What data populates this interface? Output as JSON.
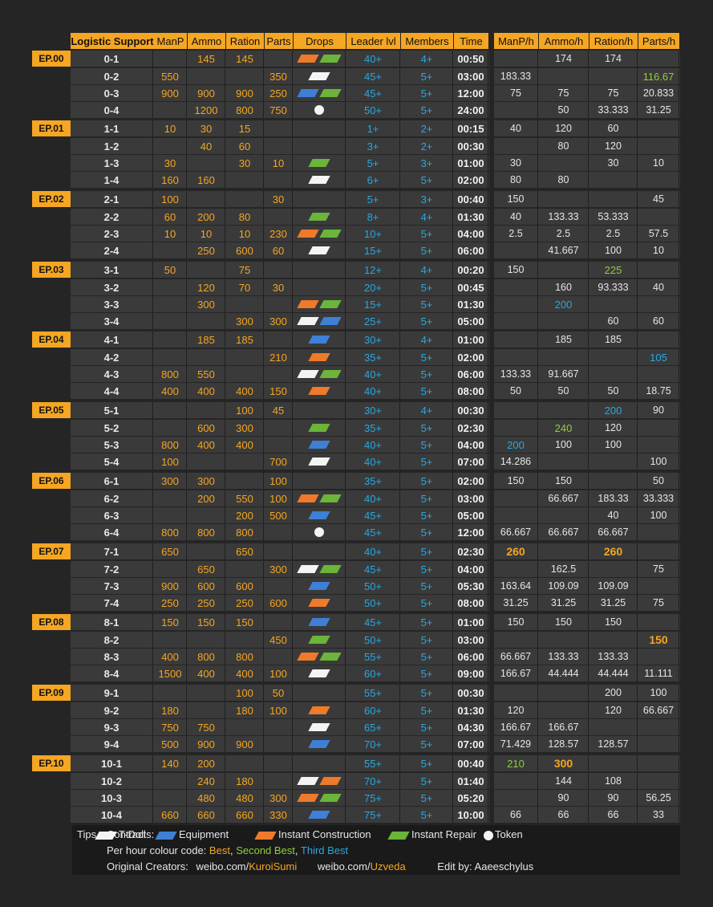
{
  "header": {
    "title": "Logistic Support",
    "cols": [
      "ManP",
      "Ammo",
      "Ration",
      "Parts",
      "Drops",
      "Leader lvl",
      "Members",
      "Time",
      "ManP/h",
      "Ammo/h",
      "Ration/h",
      "Parts/h"
    ]
  },
  "episodes": [
    {
      "label": "EP.00",
      "ops": [
        {
          "op": "0-1",
          "manp": "",
          "ammo": "145",
          "ration": "145",
          "parts": "",
          "drops": [
            "orange",
            "green"
          ],
          "lvl": "40+",
          "mem": "4+",
          "time": "00:50",
          "manph": "",
          "ammoh": "174",
          "rationh": "174",
          "partsh": ""
        },
        {
          "op": "0-2",
          "manp": "550",
          "ammo": "",
          "ration": "",
          "parts": "350",
          "drops": [
            "white"
          ],
          "lvl": "45+",
          "mem": "5+",
          "time": "03:00",
          "manph": "183.33",
          "ammoh": "",
          "rationh": "",
          "partsh": "116.67",
          "partsh_c": "second"
        },
        {
          "op": "0-3",
          "manp": "900",
          "ammo": "900",
          "ration": "900",
          "parts": "250",
          "drops": [
            "blue",
            "green"
          ],
          "lvl": "45+",
          "mem": "5+",
          "time": "12:00",
          "manph": "75",
          "ammoh": "75",
          "rationh": "75",
          "partsh": "20.833"
        },
        {
          "op": "0-4",
          "manp": "",
          "ammo": "1200",
          "ration": "800",
          "parts": "750",
          "drops": [
            "token"
          ],
          "lvl": "50+",
          "mem": "5+",
          "time": "24:00",
          "manph": "",
          "ammoh": "50",
          "rationh": "33.333",
          "partsh": "31.25"
        }
      ]
    },
    {
      "label": "EP.01",
      "ops": [
        {
          "op": "1-1",
          "manp": "10",
          "ammo": "30",
          "ration": "15",
          "parts": "",
          "drops": [],
          "lvl": "1+",
          "mem": "2+",
          "time": "00:15",
          "manph": "40",
          "ammoh": "120",
          "rationh": "60",
          "partsh": ""
        },
        {
          "op": "1-2",
          "manp": "",
          "ammo": "40",
          "ration": "60",
          "parts": "",
          "drops": [],
          "lvl": "3+",
          "mem": "2+",
          "time": "00:30",
          "manph": "",
          "ammoh": "80",
          "rationh": "120",
          "partsh": ""
        },
        {
          "op": "1-3",
          "manp": "30",
          "ammo": "",
          "ration": "30",
          "parts": "10",
          "drops": [
            "green"
          ],
          "lvl": "5+",
          "mem": "3+",
          "time": "01:00",
          "manph": "30",
          "ammoh": "",
          "rationh": "30",
          "partsh": "10"
        },
        {
          "op": "1-4",
          "manp": "160",
          "ammo": "160",
          "ration": "",
          "parts": "",
          "drops": [
            "white"
          ],
          "lvl": "6+",
          "mem": "5+",
          "time": "02:00",
          "manph": "80",
          "ammoh": "80",
          "rationh": "",
          "partsh": ""
        }
      ]
    },
    {
      "label": "EP.02",
      "ops": [
        {
          "op": "2-1",
          "manp": "100",
          "ammo": "",
          "ration": "",
          "parts": "30",
          "drops": [],
          "lvl": "5+",
          "mem": "3+",
          "time": "00:40",
          "manph": "150",
          "ammoh": "",
          "rationh": "",
          "partsh": "45"
        },
        {
          "op": "2-2",
          "manp": "60",
          "ammo": "200",
          "ration": "80",
          "parts": "",
          "drops": [
            "green"
          ],
          "lvl": "8+",
          "mem": "4+",
          "time": "01:30",
          "manph": "40",
          "ammoh": "133.33",
          "rationh": "53.333",
          "partsh": ""
        },
        {
          "op": "2-3",
          "manp": "10",
          "ammo": "10",
          "ration": "10",
          "parts": "230",
          "drops": [
            "orange",
            "green"
          ],
          "lvl": "10+",
          "mem": "5+",
          "time": "04:00",
          "manph": "2.5",
          "ammoh": "2.5",
          "rationh": "2.5",
          "partsh": "57.5"
        },
        {
          "op": "2-4",
          "manp": "",
          "ammo": "250",
          "ration": "600",
          "parts": "60",
          "drops": [
            "white"
          ],
          "lvl": "15+",
          "mem": "5+",
          "time": "06:00",
          "manph": "",
          "ammoh": "41.667",
          "rationh": "100",
          "partsh": "10"
        }
      ]
    },
    {
      "label": "EP.03",
      "ops": [
        {
          "op": "3-1",
          "manp": "50",
          "ammo": "",
          "ration": "75",
          "parts": "",
          "drops": [],
          "lvl": "12+",
          "mem": "4+",
          "time": "00:20",
          "manph": "150",
          "ammoh": "",
          "rationh": "225",
          "rationh_c": "second",
          "partsh": ""
        },
        {
          "op": "3-2",
          "manp": "",
          "ammo": "120",
          "ration": "70",
          "parts": "30",
          "drops": [],
          "lvl": "20+",
          "mem": "5+",
          "time": "00:45",
          "manph": "",
          "ammoh": "160",
          "rationh": "93.333",
          "partsh": "40"
        },
        {
          "op": "3-3",
          "manp": "",
          "ammo": "300",
          "ration": "",
          "parts": "",
          "drops": [
            "orange",
            "green"
          ],
          "lvl": "15+",
          "mem": "5+",
          "time": "01:30",
          "manph": "",
          "ammoh": "200",
          "ammoh_c": "third",
          "rationh": "",
          "partsh": ""
        },
        {
          "op": "3-4",
          "manp": "",
          "ammo": "",
          "ration": "300",
          "parts": "300",
          "drops": [
            "white",
            "blue"
          ],
          "lvl": "25+",
          "mem": "5+",
          "time": "05:00",
          "manph": "",
          "ammoh": "",
          "rationh": "60",
          "partsh": "60"
        }
      ]
    },
    {
      "label": "EP.04",
      "ops": [
        {
          "op": "4-1",
          "manp": "",
          "ammo": "185",
          "ration": "185",
          "parts": "",
          "drops": [
            "blue"
          ],
          "lvl": "30+",
          "mem": "4+",
          "time": "01:00",
          "manph": "",
          "ammoh": "185",
          "rationh": "185",
          "partsh": ""
        },
        {
          "op": "4-2",
          "manp": "",
          "ammo": "",
          "ration": "",
          "parts": "210",
          "drops": [
            "orange"
          ],
          "lvl": "35+",
          "mem": "5+",
          "time": "02:00",
          "manph": "",
          "ammoh": "",
          "rationh": "",
          "partsh": "105",
          "partsh_c": "third"
        },
        {
          "op": "4-3",
          "manp": "800",
          "ammo": "550",
          "ration": "",
          "parts": "",
          "drops": [
            "white",
            "green"
          ],
          "lvl": "40+",
          "mem": "5+",
          "time": "06:00",
          "manph": "133.33",
          "ammoh": "91.667",
          "rationh": "",
          "partsh": ""
        },
        {
          "op": "4-4",
          "manp": "400",
          "ammo": "400",
          "ration": "400",
          "parts": "150",
          "drops": [
            "orange"
          ],
          "lvl": "40+",
          "mem": "5+",
          "time": "08:00",
          "manph": "50",
          "ammoh": "50",
          "rationh": "50",
          "partsh": "18.75"
        }
      ]
    },
    {
      "label": "EP.05",
      "ops": [
        {
          "op": "5-1",
          "manp": "",
          "ammo": "",
          "ration": "100",
          "parts": "45",
          "drops": [],
          "lvl": "30+",
          "mem": "4+",
          "time": "00:30",
          "manph": "",
          "ammoh": "",
          "rationh": "200",
          "rationh_c": "third",
          "partsh": "90"
        },
        {
          "op": "5-2",
          "manp": "",
          "ammo": "600",
          "ration": "300",
          "parts": "",
          "drops": [
            "green"
          ],
          "lvl": "35+",
          "mem": "5+",
          "time": "02:30",
          "manph": "",
          "ammoh": "240",
          "ammoh_c": "second",
          "rationh": "120",
          "partsh": ""
        },
        {
          "op": "5-3",
          "manp": "800",
          "ammo": "400",
          "ration": "400",
          "parts": "",
          "drops": [
            "blue"
          ],
          "lvl": "40+",
          "mem": "5+",
          "time": "04:00",
          "manph": "200",
          "manph_c": "third",
          "ammoh": "100",
          "rationh": "100",
          "partsh": ""
        },
        {
          "op": "5-4",
          "manp": "100",
          "ammo": "",
          "ration": "",
          "parts": "700",
          "drops": [
            "white"
          ],
          "lvl": "40+",
          "mem": "5+",
          "time": "07:00",
          "manph": "14.286",
          "ammoh": "",
          "rationh": "",
          "partsh": "100"
        }
      ]
    },
    {
      "label": "EP.06",
      "ops": [
        {
          "op": "6-1",
          "manp": "300",
          "ammo": "300",
          "ration": "",
          "parts": "100",
          "drops": [],
          "lvl": "35+",
          "mem": "5+",
          "time": "02:00",
          "manph": "150",
          "ammoh": "150",
          "rationh": "",
          "partsh": "50"
        },
        {
          "op": "6-2",
          "manp": "",
          "ammo": "200",
          "ration": "550",
          "parts": "100",
          "drops": [
            "orange",
            "green"
          ],
          "lvl": "40+",
          "mem": "5+",
          "time": "03:00",
          "manph": "",
          "ammoh": "66.667",
          "rationh": "183.33",
          "partsh": "33.333"
        },
        {
          "op": "6-3",
          "manp": "",
          "ammo": "",
          "ration": "200",
          "parts": "500",
          "drops": [
            "blue"
          ],
          "lvl": "45+",
          "mem": "5+",
          "time": "05:00",
          "manph": "",
          "ammoh": "",
          "rationh": "40",
          "partsh": "100"
        },
        {
          "op": "6-4",
          "manp": "800",
          "ammo": "800",
          "ration": "800",
          "parts": "",
          "drops": [
            "token"
          ],
          "lvl": "45+",
          "mem": "5+",
          "time": "12:00",
          "manph": "66.667",
          "ammoh": "66.667",
          "rationh": "66.667",
          "partsh": ""
        }
      ]
    },
    {
      "label": "EP.07",
      "ops": [
        {
          "op": "7-1",
          "manp": "650",
          "ammo": "",
          "ration": "650",
          "parts": "",
          "drops": [],
          "lvl": "40+",
          "mem": "5+",
          "time": "02:30",
          "manph": "260",
          "manph_c": "best",
          "ammoh": "",
          "rationh": "260",
          "rationh_c": "best",
          "partsh": ""
        },
        {
          "op": "7-2",
          "manp": "",
          "ammo": "650",
          "ration": "",
          "parts": "300",
          "drops": [
            "white",
            "green"
          ],
          "lvl": "45+",
          "mem": "5+",
          "time": "04:00",
          "manph": "",
          "ammoh": "162.5",
          "rationh": "",
          "partsh": "75"
        },
        {
          "op": "7-3",
          "manp": "900",
          "ammo": "600",
          "ration": "600",
          "parts": "",
          "drops": [
            "blue"
          ],
          "lvl": "50+",
          "mem": "5+",
          "time": "05:30",
          "manph": "163.64",
          "ammoh": "109.09",
          "rationh": "109.09",
          "partsh": ""
        },
        {
          "op": "7-4",
          "manp": "250",
          "ammo": "250",
          "ration": "250",
          "parts": "600",
          "drops": [
            "orange"
          ],
          "lvl": "50+",
          "mem": "5+",
          "time": "08:00",
          "manph": "31.25",
          "ammoh": "31.25",
          "rationh": "31.25",
          "partsh": "75"
        }
      ]
    },
    {
      "label": "EP.08",
      "ops": [
        {
          "op": "8-1",
          "manp": "150",
          "ammo": "150",
          "ration": "150",
          "parts": "",
          "drops": [
            "blue"
          ],
          "lvl": "45+",
          "mem": "5+",
          "time": "01:00",
          "manph": "150",
          "ammoh": "150",
          "rationh": "150",
          "partsh": ""
        },
        {
          "op": "8-2",
          "manp": "",
          "ammo": "",
          "ration": "",
          "parts": "450",
          "drops": [
            "green"
          ],
          "lvl": "50+",
          "mem": "5+",
          "time": "03:00",
          "manph": "",
          "ammoh": "",
          "rationh": "",
          "partsh": "150",
          "partsh_c": "best"
        },
        {
          "op": "8-3",
          "manp": "400",
          "ammo": "800",
          "ration": "800",
          "parts": "",
          "drops": [
            "orange",
            "green"
          ],
          "lvl": "55+",
          "mem": "5+",
          "time": "06:00",
          "manph": "66.667",
          "ammoh": "133.33",
          "rationh": "133.33",
          "partsh": ""
        },
        {
          "op": "8-4",
          "manp": "1500",
          "ammo": "400",
          "ration": "400",
          "parts": "100",
          "drops": [
            "white"
          ],
          "lvl": "60+",
          "mem": "5+",
          "time": "09:00",
          "manph": "166.67",
          "ammoh": "44.444",
          "rationh": "44.444",
          "partsh": "11.111"
        }
      ]
    },
    {
      "label": "EP.09",
      "ops": [
        {
          "op": "9-1",
          "manp": "",
          "ammo": "",
          "ration": "100",
          "parts": "50",
          "drops": [],
          "lvl": "55+",
          "mem": "5+",
          "time": "00:30",
          "manph": "",
          "ammoh": "",
          "rationh": "200",
          "partsh": "100"
        },
        {
          "op": "9-2",
          "manp": "180",
          "ammo": "",
          "ration": "180",
          "parts": "100",
          "drops": [
            "orange"
          ],
          "lvl": "60+",
          "mem": "5+",
          "time": "01:30",
          "manph": "120",
          "ammoh": "",
          "rationh": "120",
          "partsh": "66.667"
        },
        {
          "op": "9-3",
          "manp": "750",
          "ammo": "750",
          "ration": "",
          "parts": "",
          "drops": [
            "white"
          ],
          "lvl": "65+",
          "mem": "5+",
          "time": "04:30",
          "manph": "166.67",
          "ammoh": "166.67",
          "rationh": "",
          "partsh": ""
        },
        {
          "op": "9-4",
          "manp": "500",
          "ammo": "900",
          "ration": "900",
          "parts": "",
          "drops": [
            "blue"
          ],
          "lvl": "70+",
          "mem": "5+",
          "time": "07:00",
          "manph": "71.429",
          "ammoh": "128.57",
          "rationh": "128.57",
          "partsh": ""
        }
      ]
    },
    {
      "label": "EP.10",
      "ops": [
        {
          "op": "10-1",
          "manp": "140",
          "ammo": "200",
          "ration": "",
          "parts": "",
          "drops": [],
          "lvl": "55+",
          "mem": "5+",
          "time": "00:40",
          "manph": "210",
          "manph_c": "second",
          "ammoh": "300",
          "ammoh_c": "best",
          "rationh": "",
          "partsh": ""
        },
        {
          "op": "10-2",
          "manp": "",
          "ammo": "240",
          "ration": "180",
          "parts": "",
          "drops": [
            "white",
            "orange"
          ],
          "lvl": "70+",
          "mem": "5+",
          "time": "01:40",
          "manph": "",
          "ammoh": "144",
          "rationh": "108",
          "partsh": ""
        },
        {
          "op": "10-3",
          "manp": "",
          "ammo": "480",
          "ration": "480",
          "parts": "300",
          "drops": [
            "orange",
            "green"
          ],
          "lvl": "75+",
          "mem": "5+",
          "time": "05:20",
          "manph": "",
          "ammoh": "90",
          "rationh": "90",
          "partsh": "56.25"
        },
        {
          "op": "10-4",
          "manp": "660",
          "ammo": "660",
          "ration": "660",
          "parts": "330",
          "drops": [
            "blue"
          ],
          "lvl": "75+",
          "mem": "5+",
          "time": "10:00",
          "manph": "66",
          "ammoh": "66",
          "rationh": "66",
          "partsh": "33"
        }
      ]
    }
  ],
  "tips": {
    "label": "Tips",
    "contracts_label": "Contracts:",
    "legend": [
      {
        "kind": "white",
        "text": "T-Doll"
      },
      {
        "kind": "blue",
        "text": "Equipment"
      },
      {
        "kind": "orange",
        "text": "Instant Construction"
      },
      {
        "kind": "green",
        "text": "Instant Repair"
      },
      {
        "kind": "token",
        "text": "Token"
      }
    ],
    "colour_label": "Per hour colour code:",
    "best": "Best",
    "second": "Second Best",
    "third": "Third Best",
    "sep": ",",
    "creators_label": "Original Creators:",
    "weibo_prefix": "weibo.com/",
    "creator1": "KuroiSumi",
    "creator2": "Uzveda",
    "editor": "Edit by: Aaeeschylus"
  },
  "colors": {
    "accent": "#f5a623",
    "level": "#29a8e0",
    "second": "#8fcf3c",
    "third": "#29a8e0",
    "white_drop": "#f4f4f4",
    "blue_drop": "#3f7fd6",
    "orange_drop": "#ee7a2a",
    "green_drop": "#6ab53a"
  }
}
